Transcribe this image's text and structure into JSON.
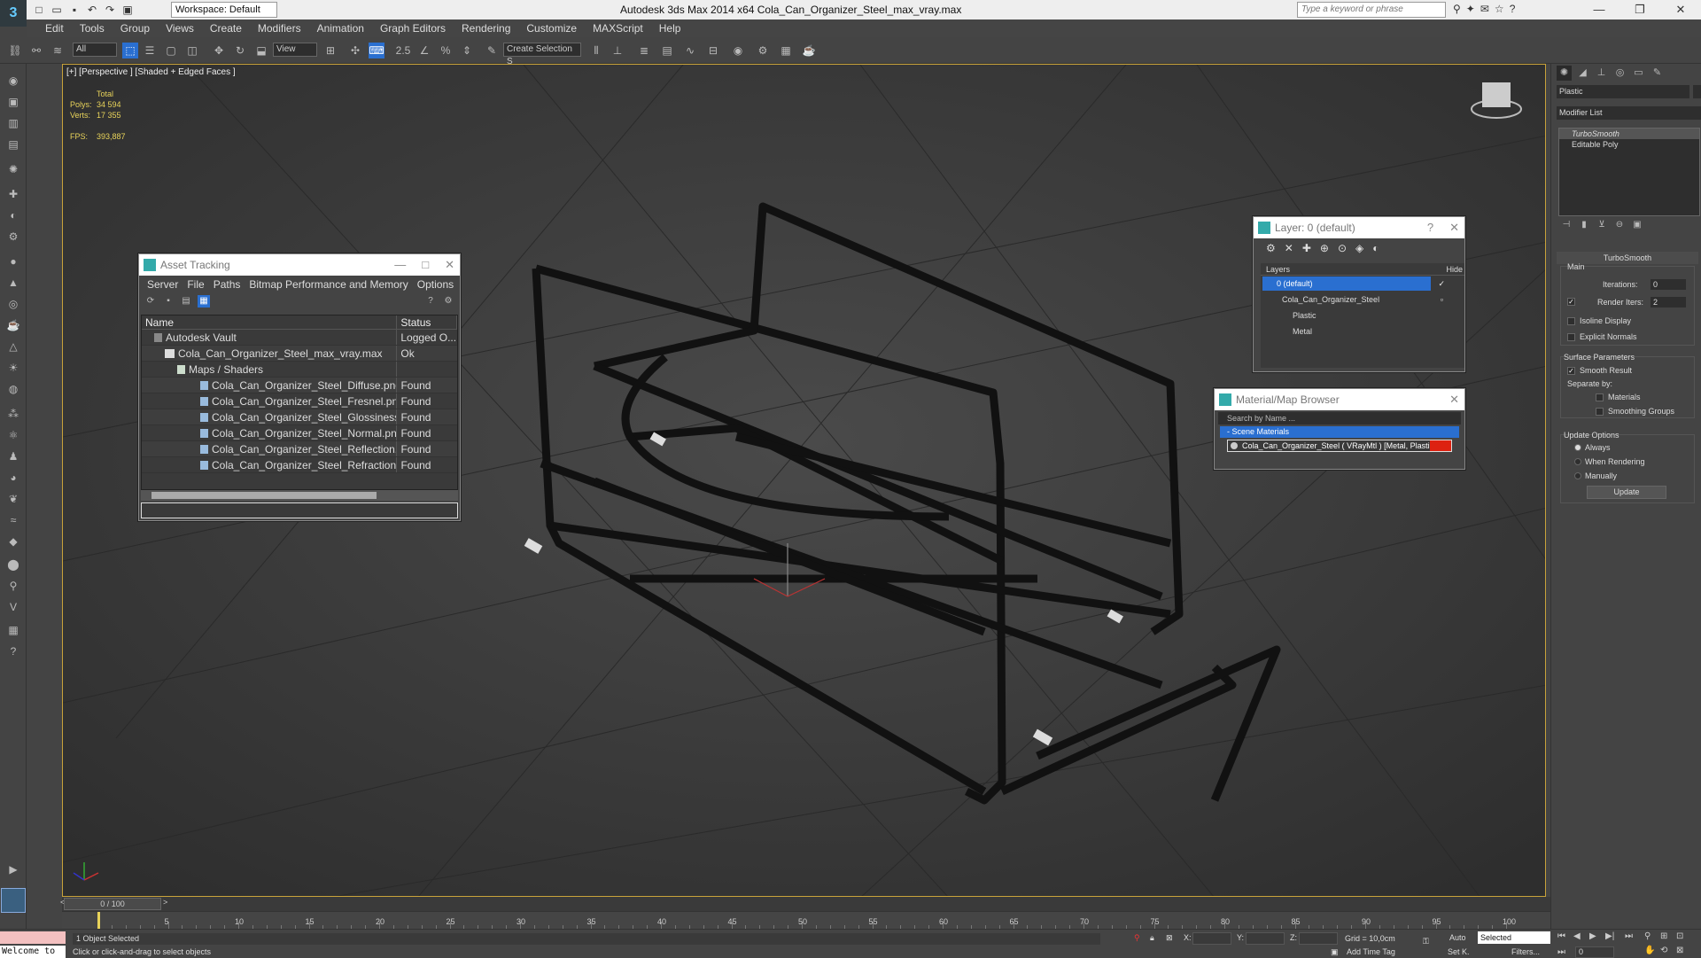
{
  "titlebar": {
    "workspace": "Workspace: Default",
    "title": "Autodesk 3ds Max  2014 x64      Cola_Can_Organizer_Steel_max_vray.max",
    "search_placeholder": "Type a keyword or phrase"
  },
  "menu": [
    "Edit",
    "Tools",
    "Group",
    "Views",
    "Create",
    "Modifiers",
    "Animation",
    "Graph Editors",
    "Rendering",
    "Customize",
    "MAXScript",
    "Help"
  ],
  "toolbar": {
    "filter": "All",
    "refcoord": "View",
    "selection_set": "Create Selection S"
  },
  "viewport": {
    "label": "[+] [Perspective ] [Shaded + Edged Faces ]",
    "stats_total": "Total",
    "polys_label": "Polys:",
    "polys_value": "34 594",
    "verts_label": "Verts:",
    "verts_value": "17 355",
    "fps_label": "FPS:",
    "fps_value": "393,887"
  },
  "asset_tracking": {
    "title": "Asset Tracking",
    "menu": [
      "Server",
      "File",
      "Paths",
      "Bitmap Performance and Memory",
      "Options"
    ],
    "col_name": "Name",
    "col_status": "Status",
    "rows": [
      {
        "name": "Autodesk Vault",
        "status": "Logged O..."
      },
      {
        "name": "Cola_Can_Organizer_Steel_max_vray.max",
        "status": "Ok"
      },
      {
        "name": "Maps / Shaders",
        "status": ""
      },
      {
        "name": "Cola_Can_Organizer_Steel_Diffuse.png",
        "status": "Found"
      },
      {
        "name": "Cola_Can_Organizer_Steel_Fresnel.png",
        "status": "Found"
      },
      {
        "name": "Cola_Can_Organizer_Steel_Glossiness.png",
        "status": "Found"
      },
      {
        "name": "Cola_Can_Organizer_Steel_Normal.png",
        "status": "Found"
      },
      {
        "name": "Cola_Can_Organizer_Steel_Reflection.png",
        "status": "Found"
      },
      {
        "name": "Cola_Can_Organizer_Steel_Refraction.png",
        "status": "Found"
      }
    ]
  },
  "layer_window": {
    "title": "Layer: 0 (default)",
    "help": "?",
    "col_layers": "Layers",
    "col_hide": "Hide",
    "items": [
      "0 (default)",
      "Cola_Can_Organizer_Steel",
      "Plastic",
      "Metal"
    ]
  },
  "material_browser": {
    "title": "Material/Map Browser",
    "search": "Search by Name ...",
    "group": "- Scene Materials",
    "item": "Cola_Can_Organizer_Steel  ( VRayMtl ) [Metal, Plastic]"
  },
  "command_panel": {
    "object_name": "Plastic",
    "modifier_list": "Modifier List",
    "stack": [
      "TurboSmooth",
      "Editable Poly"
    ],
    "rollout": "TurboSmooth",
    "main": "Main",
    "iterations_label": "Iterations:",
    "iterations_value": "0",
    "render_iters_label": "Render Iters:",
    "render_iters_value": "2",
    "isoline": "Isoline Display",
    "explicit_normals": "Explicit Normals",
    "surface_params": "Surface Parameters",
    "smooth_result": "Smooth Result",
    "separate_by": "Separate by:",
    "materials": "Materials",
    "smoothing_groups": "Smoothing Groups",
    "update_options": "Update Options",
    "always": "Always",
    "when_rendering": "When Rendering",
    "manually": "Manually",
    "update_btn": "Update"
  },
  "timeline": {
    "frame": "0 / 100",
    "ticks": [
      "5",
      "10",
      "15",
      "20",
      "25",
      "30",
      "35",
      "40",
      "45",
      "50",
      "55",
      "60",
      "65",
      "70",
      "75",
      "80",
      "85",
      "90",
      "95",
      "100"
    ]
  },
  "statusbar": {
    "welcome": "Welcome to",
    "selected": "1 Object Selected",
    "prompt": "Click or click-and-drag to select objects",
    "x": "X:",
    "y": "Y:",
    "z": "Z:",
    "grid": "Grid = 10,0cm",
    "add_time_tag": "Add Time Tag",
    "auto": "Auto",
    "setk": "Set K.",
    "selected_mode": "Selected",
    "filters": "Filters...",
    "frame_value": "0"
  }
}
